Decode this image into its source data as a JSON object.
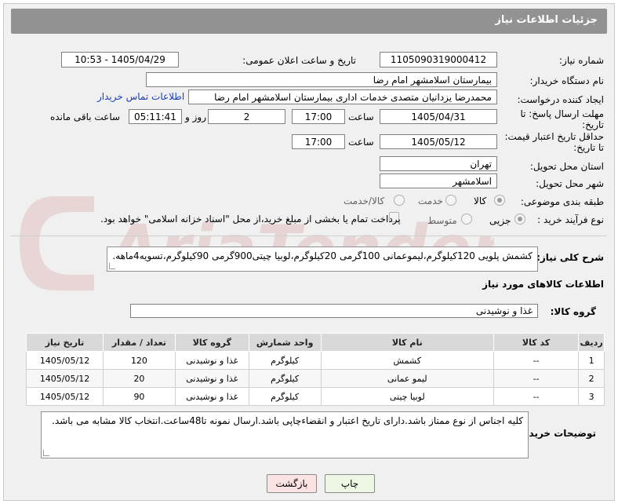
{
  "header": {
    "title": "جزئیات اطلاعات نیاز"
  },
  "form": {
    "need_number": {
      "label": "شماره نیاز:",
      "value": "1105090319000412"
    },
    "announce_date": {
      "label": "تاریخ و ساعت اعلان عمومی:",
      "value": "1405/04/29 - 10:53"
    },
    "buyer_org": {
      "label": "نام دستگاه خریدار:",
      "value": "بیمارستان اسلامشهر   امام رضا"
    },
    "requester": {
      "label": "ایجاد کننده درخواست:",
      "value": "محمدرضا یزدانیان متصدی خدمات اداری بیمارستان اسلامشهر   امام رضا",
      "contact_link": "اطلاعات تماس خریدار"
    },
    "reply_deadline": {
      "label_line1": "مهلت ارسال پاسخ: تا",
      "label_line2": "تاریخ:",
      "date": "1405/04/31",
      "time_label": "ساعت",
      "time": "17:00",
      "days": "2",
      "days_label": "روز و",
      "remaining": "05:11:41",
      "remaining_label": "ساعت باقی مانده"
    },
    "price_validity": {
      "label_line1": "حداقل تاریخ اعتبار قیمت:",
      "label_line2": "تا تاریخ:",
      "date": "1405/05/12",
      "time_label": "ساعت",
      "time": "17:00"
    },
    "delivery_province": {
      "label": "استان محل تحویل:",
      "value": "تهران"
    },
    "delivery_city": {
      "label": "شهر محل تحویل:",
      "value": "اسلامشهر"
    },
    "category": {
      "label": "طبقه بندی موضوعی:",
      "options": [
        "کالا",
        "خدمت",
        "کالا/خدمت"
      ],
      "selected": "کالا"
    },
    "purchase_type": {
      "label": "نوع فرآیند خرید :",
      "options": [
        "جزیی",
        "متوسط"
      ],
      "selected": "جزیی",
      "payment_note": "پرداخت تمام یا بخشی از مبلغ خرید،از محل \"اسناد خزانه اسلامی\" خواهد بود."
    }
  },
  "description": {
    "label": "شرح کلی نیاز:",
    "value": "کشمش پلویی 120کیلوگرم،لیموعمانی 100گرمی 20کیلوگرم،لوبیا چیتی900گرمی 90کیلوگرم،تسویه4ماهه."
  },
  "goods_info": {
    "title": "اطلاعات کالاهای مورد نیاز"
  },
  "goods_group": {
    "label": "گروه کالا:",
    "value": "غذا و نوشیدنی"
  },
  "table": {
    "headers": [
      "ردیف",
      "کد کالا",
      "نام کالا",
      "واحد شمارش",
      "گروه کالا",
      "تعداد / مقدار",
      "تاریخ نیاز"
    ],
    "rows": [
      [
        "1",
        "--",
        "کشمش",
        "کیلوگرم",
        "غذا و نوشیدنی",
        "120",
        "1405/05/12"
      ],
      [
        "2",
        "--",
        "لیمو عمانی",
        "کیلوگرم",
        "غذا و نوشیدنی",
        "20",
        "1405/05/12"
      ],
      [
        "3",
        "--",
        "لوبیا چیتی",
        "کیلوگرم",
        "غذا و نوشیدنی",
        "90",
        "1405/05/12"
      ]
    ]
  },
  "buyer_notes": {
    "label": "توضیحات خریدار:",
    "value": "کلیه اجناس از نوع ممتاز باشد.دارای تاریخ اعتبار و انقضاءچاپی باشد.ارسال نمونه تا48ساعت.انتخاب کالا مشابه می باشد."
  },
  "buttons": {
    "print": "چاپ",
    "back": "بازگشت"
  },
  "watermark": {
    "text": "AriaTender.net"
  }
}
